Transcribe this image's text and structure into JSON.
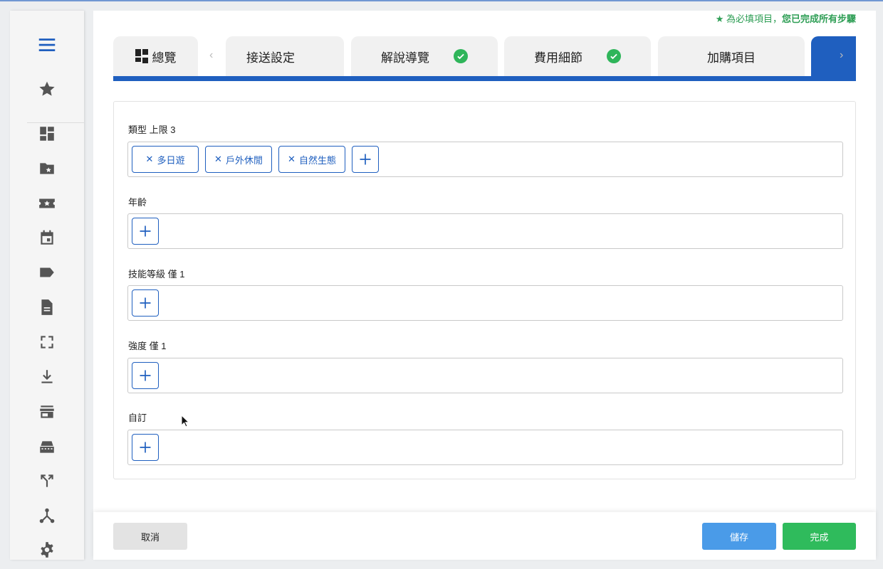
{
  "colors": {
    "accent": "#1f5fbf",
    "success": "#2fb55a",
    "save": "#4a9be8",
    "done": "#2fbb5c"
  },
  "sidebar": {
    "icons": [
      "menu-icon",
      "star-icon",
      "dashboard-icon",
      "folder-star-icon",
      "ticket-star-icon",
      "calendar-icon",
      "label-icon",
      "document-icon",
      "fullscreen-icon",
      "download-icon",
      "store-icon",
      "printer-icon",
      "merge-icon",
      "tree-icon",
      "settings-icon"
    ]
  },
  "header": {
    "required_prefix": "★ 為必填項目，",
    "required_done": "您已完成所有步驟"
  },
  "tabs": [
    {
      "label": "總覽",
      "icon": "grid-icon"
    },
    {
      "label": "接送設定"
    },
    {
      "label": "解說導覽",
      "done": true
    },
    {
      "label": "費用細節",
      "done": true
    },
    {
      "label": "加購項目"
    }
  ],
  "nav": {
    "prev": "‹",
    "next": "›"
  },
  "form": {
    "type_label": "類型 上限 3",
    "type_chips": [
      "多日遊",
      "戶外休閒",
      "自然生態"
    ],
    "age_label": "年齡",
    "skill_label": "技能等級 僅 1",
    "intensity_label": "強度 僅 1",
    "custom_label": "自訂"
  },
  "footer": {
    "cancel": "取消",
    "save": "儲存",
    "done": "完成"
  }
}
